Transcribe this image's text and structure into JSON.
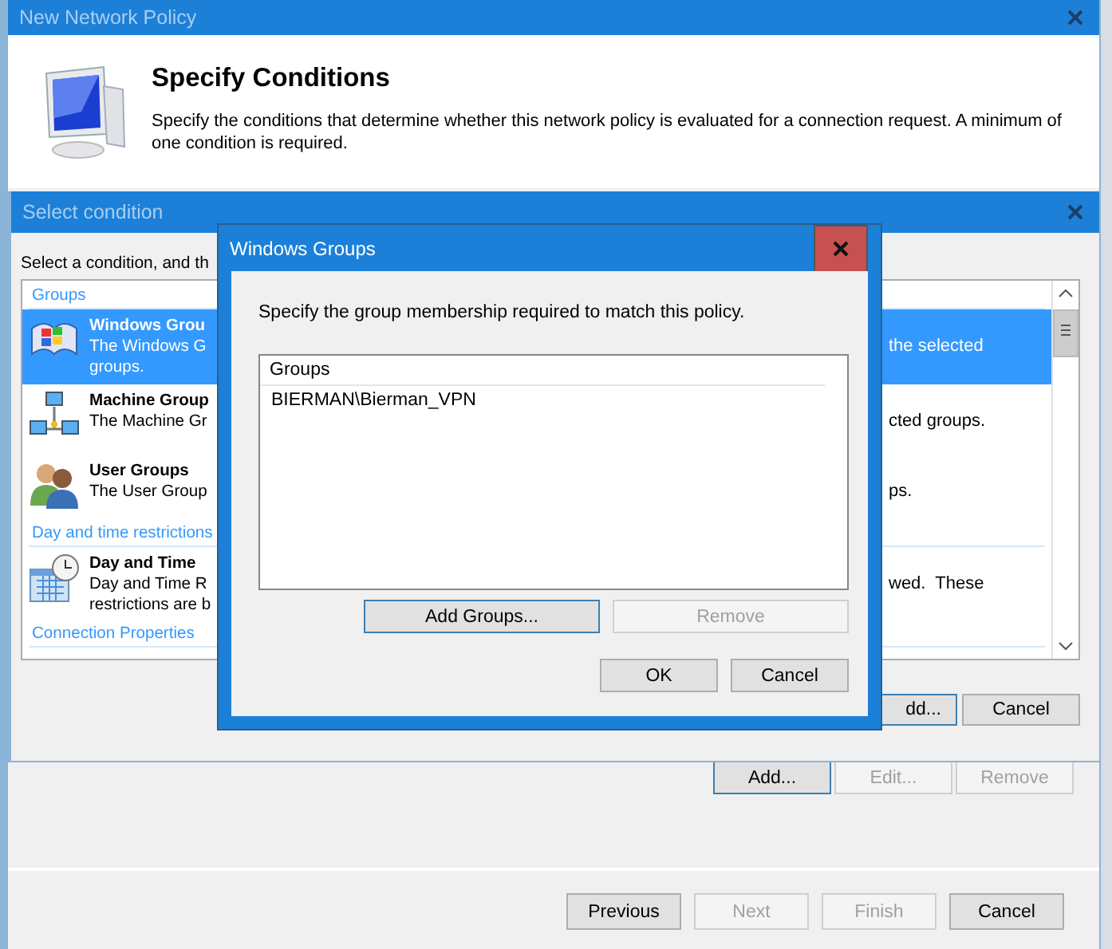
{
  "main_window": {
    "title": "New Network Policy",
    "heading": "Specify Conditions",
    "description": "Specify the conditions that determine whether this network policy is evaluated for a connection request. A minimum of one condition is required.",
    "condition_buttons": [
      {
        "label": "Add...",
        "disabled": false,
        "focused": true
      },
      {
        "label": "Edit...",
        "disabled": true,
        "focused": false
      },
      {
        "label": "Remove",
        "disabled": true,
        "focused": false
      }
    ],
    "nav_buttons": [
      {
        "label": "Previous",
        "disabled": false,
        "focused": false
      },
      {
        "label": "Next",
        "disabled": true,
        "focused": false
      },
      {
        "label": "Finish",
        "disabled": true,
        "focused": false
      },
      {
        "label": "Cancel",
        "disabled": false,
        "focused": false
      }
    ]
  },
  "select_condition": {
    "title": "Select condition",
    "instruction": "Select a condition, and th",
    "sections": [
      {
        "heading": "Groups",
        "items": [
          {
            "kind": "windows-groups",
            "title": "Windows Grou",
            "lines": [
              "The Windows G",
              "groups."
            ],
            "right_text": "the selected",
            "selected": true
          },
          {
            "kind": "machine-groups",
            "title": "Machine Group",
            "lines": [
              "The Machine Gr"
            ],
            "right_text": "cted groups.",
            "selected": false
          },
          {
            "kind": "user-groups",
            "title": "User Groups",
            "lines": [
              "The User Group"
            ],
            "right_text": "ps.",
            "selected": false
          }
        ]
      },
      {
        "heading": "Day and time restrictions",
        "items": [
          {
            "kind": "day-time",
            "title": "Day and Time",
            "lines": [
              "Day and Time R",
              "restrictions are b"
            ],
            "right_text": "wed.  These",
            "selected": false
          }
        ]
      },
      {
        "heading": "Connection Properties"
      }
    ],
    "buttons": [
      {
        "label": "dd...",
        "disabled": false,
        "focused": true
      },
      {
        "label": "Cancel",
        "disabled": false,
        "focused": false
      }
    ]
  },
  "dialog": {
    "title": "Windows Groups",
    "instruction": "Specify the group membership required to match this policy.",
    "column": "Groups",
    "rows": [
      "BIERMAN\\Bierman_VPN"
    ],
    "list_buttons": [
      {
        "label": "Add Groups...",
        "disabled": false,
        "focused": true
      },
      {
        "label": "Remove",
        "disabled": true,
        "focused": false
      }
    ],
    "buttons": [
      {
        "label": "OK",
        "disabled": false,
        "focused": false
      },
      {
        "label": "Cancel",
        "disabled": false,
        "focused": false
      }
    ]
  }
}
